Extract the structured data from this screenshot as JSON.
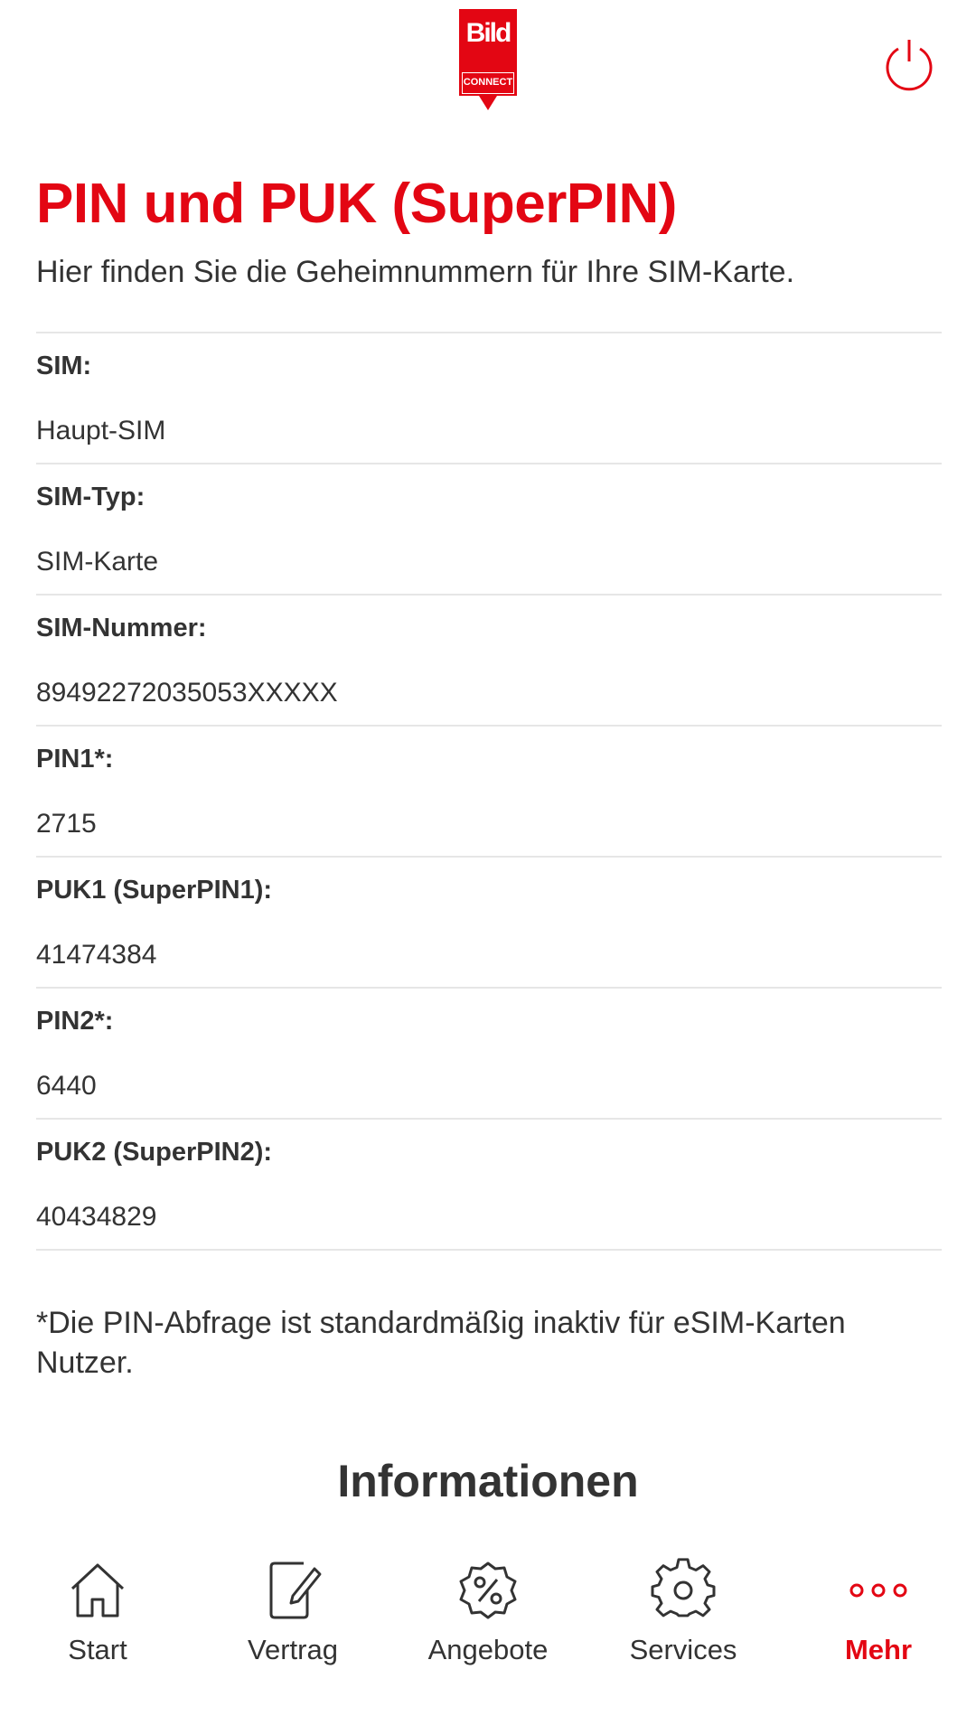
{
  "header": {
    "logo_text_top": "Bild",
    "logo_text_bottom": "CONNECT",
    "logout_icon": "power-icon"
  },
  "page": {
    "title": "PIN und PUK (SuperPIN)",
    "subtitle": "Hier finden Sie die Geheimnummern für Ihre SIM-Karte."
  },
  "sim_details": [
    {
      "label": "SIM:",
      "value": "Haupt-SIM"
    },
    {
      "label": "SIM-Typ:",
      "value": "SIM-Karte"
    },
    {
      "label": "SIM-Nummer:",
      "value": "89492272035053XXXXX"
    },
    {
      "label": "PIN1*:",
      "value": "2715"
    },
    {
      "label": "PUK1 (SuperPIN1):",
      "value": "41474384"
    },
    {
      "label": "PIN2*:",
      "value": "6440"
    },
    {
      "label": "PUK2 (SuperPIN2):",
      "value": "40434829"
    }
  ],
  "footnote": "*Die PIN-Abfrage ist standardmäßig inaktiv für eSIM-Karten Nutzer.",
  "section": {
    "heading": "Informationen"
  },
  "bottom_nav": [
    {
      "label": "Start",
      "icon": "home-icon"
    },
    {
      "label": "Vertrag",
      "icon": "edit-document-icon"
    },
    {
      "label": "Angebote",
      "icon": "percent-badge-icon"
    },
    {
      "label": "Services",
      "icon": "gear-icon"
    },
    {
      "label": "Mehr",
      "icon": "more-dots-icon",
      "active": true
    }
  ],
  "colors": {
    "brand_red": "#e30613",
    "text": "#333333",
    "divider": "#e6e6e6"
  }
}
